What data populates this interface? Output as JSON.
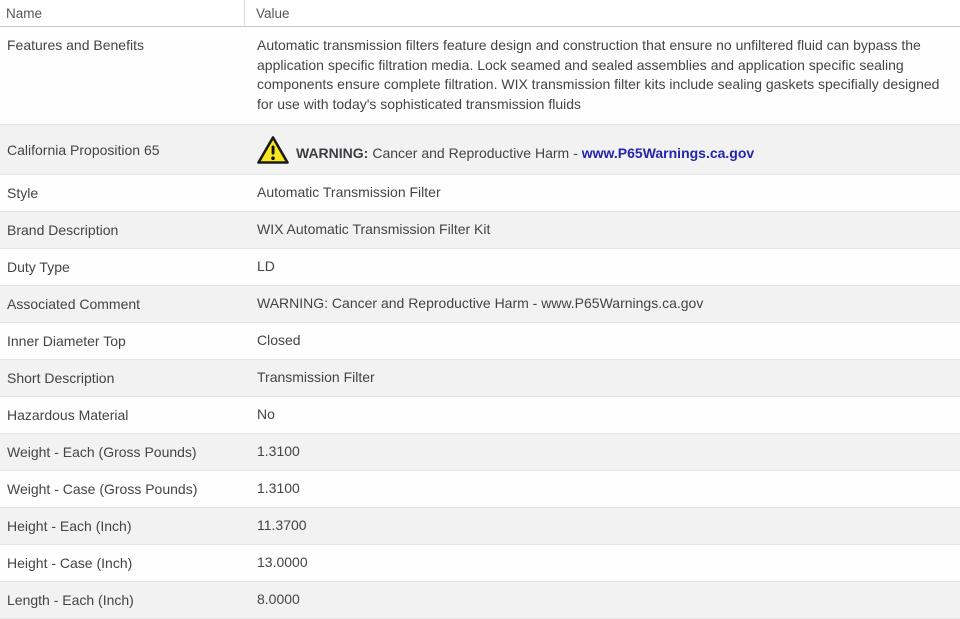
{
  "table": {
    "header": {
      "name": "Name",
      "value": "Value"
    },
    "rows": [
      {
        "type": "paragraph",
        "name": "Features and Benefits",
        "value": "Automatic transmission filters feature design and construction that ensure no unfiltered fluid can bypass the application specific filtration media. Lock seamed and sealed assemblies and application specific sealing components ensure complete filtration. WIX transmission filter kits include sealing gaskets specifially designed for use with today's sophisticated transmission fluids"
      },
      {
        "type": "warning",
        "name": "California Proposition 65",
        "icon": "warning-triangle-icon",
        "warning_label": "WARNING:",
        "warning_text": "Cancer and Reproductive Harm -",
        "warning_link": "www.P65Warnings.ca.gov"
      },
      {
        "name": "Style",
        "value": "Automatic Transmission Filter"
      },
      {
        "name": "Brand Description",
        "value": "WIX Automatic Transmission Filter Kit"
      },
      {
        "name": "Duty Type",
        "value": "LD"
      },
      {
        "name": "Associated Comment",
        "value": "WARNING: Cancer and Reproductive Harm - www.P65Warnings.ca.gov"
      },
      {
        "name": "Inner Diameter Top",
        "value": "Closed"
      },
      {
        "name": "Short Description",
        "value": "Transmission Filter"
      },
      {
        "name": "Hazardous Material",
        "value": "No"
      },
      {
        "name": "Weight - Each (Gross Pounds)",
        "value": "1.3100"
      },
      {
        "name": "Weight - Case (Gross Pounds)",
        "value": "1.3100"
      },
      {
        "name": "Height - Each (Inch)",
        "value": "11.3700"
      },
      {
        "name": "Height - Case (Inch)",
        "value": "13.0000"
      },
      {
        "name": "Length - Each (Inch)",
        "value": "8.0000"
      }
    ]
  },
  "colors": {
    "link": "#2424ad",
    "warning_yellow": "#f8e71c",
    "warning_outline": "#1a1a1a",
    "alt_row_bg": "#f3f2f2",
    "row_border": "#e5e4e4",
    "header_border": "#c9c9c9",
    "text": "#424448"
  }
}
